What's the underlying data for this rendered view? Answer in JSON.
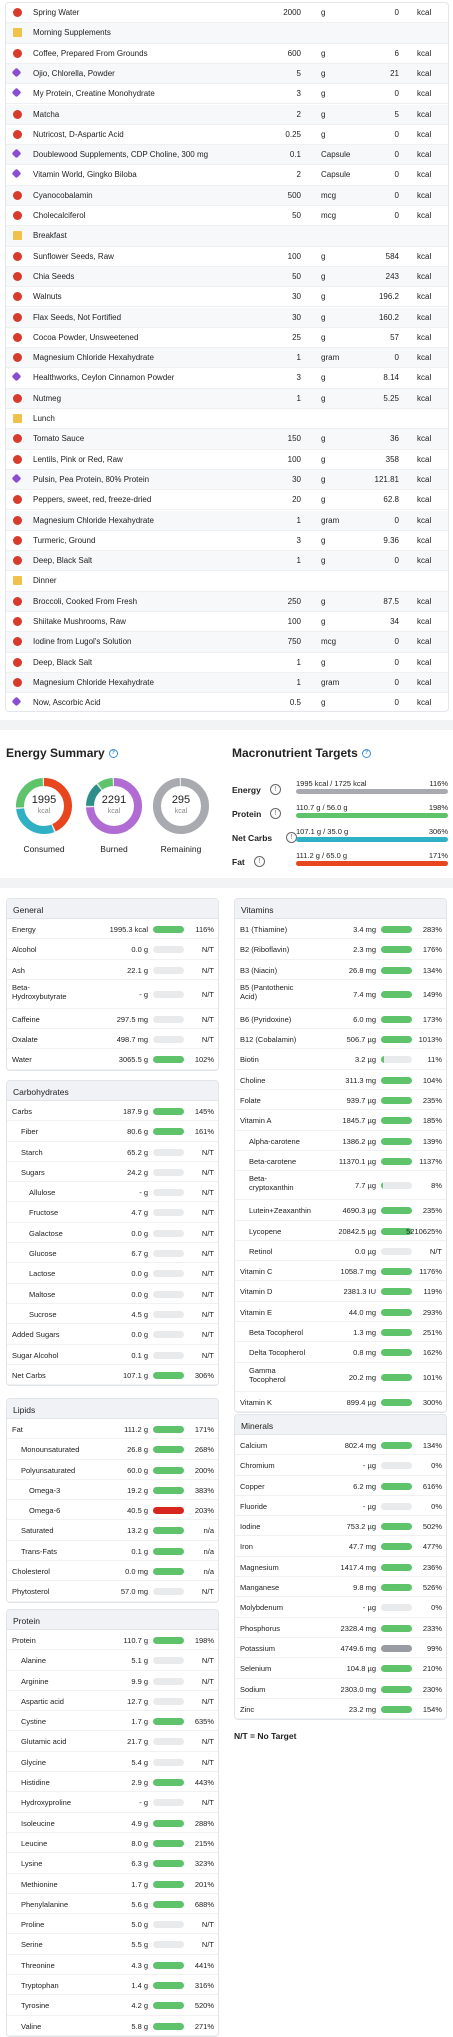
{
  "diary": [
    {
      "t": "food",
      "n": "Spring Water",
      "a": "2000",
      "u": "g",
      "k": "0",
      "ku": "kcal"
    },
    {
      "t": "folder",
      "n": "Morning Supplements"
    },
    {
      "t": "food",
      "n": "Coffee, Prepared From Grounds",
      "a": "600",
      "u": "g",
      "k": "6",
      "ku": "kcal"
    },
    {
      "t": "supp",
      "n": "Ojio, Chlorella, Powder",
      "a": "5",
      "u": "g",
      "k": "21",
      "ku": "kcal"
    },
    {
      "t": "supp",
      "n": "My Protein, Creatine Monohydrate",
      "a": "3",
      "u": "g",
      "k": "0",
      "ku": "kcal"
    },
    {
      "t": "food",
      "n": "Matcha",
      "a": "2",
      "u": "g",
      "k": "5",
      "ku": "kcal"
    },
    {
      "t": "food",
      "n": "Nutricost, D-Aspartic Acid",
      "a": "0.25",
      "u": "g",
      "k": "0",
      "ku": "kcal"
    },
    {
      "t": "supp",
      "n": "Doublewood Supplements, CDP Choline, 300 mg",
      "a": "0.1",
      "u": "Capsule",
      "k": "0",
      "ku": "kcal"
    },
    {
      "t": "supp",
      "n": "Vitamin World, Gingko Biloba",
      "a": "2",
      "u": "Capsule",
      "k": "0",
      "ku": "kcal"
    },
    {
      "t": "food",
      "n": "Cyanocobalamin",
      "a": "500",
      "u": "mcg",
      "k": "0",
      "ku": "kcal"
    },
    {
      "t": "food",
      "n": "Cholecalciferol",
      "a": "50",
      "u": "mcg",
      "k": "0",
      "ku": "kcal"
    },
    {
      "t": "folder",
      "n": "Breakfast"
    },
    {
      "t": "food",
      "n": "Sunflower Seeds, Raw",
      "a": "100",
      "u": "g",
      "k": "584",
      "ku": "kcal"
    },
    {
      "t": "food",
      "n": "Chia Seeds",
      "a": "50",
      "u": "g",
      "k": "243",
      "ku": "kcal"
    },
    {
      "t": "food",
      "n": "Walnuts",
      "a": "30",
      "u": "g",
      "k": "196.2",
      "ku": "kcal"
    },
    {
      "t": "food",
      "n": "Flax Seeds, Not Fortified",
      "a": "30",
      "u": "g",
      "k": "160.2",
      "ku": "kcal"
    },
    {
      "t": "food",
      "n": "Cocoa Powder, Unsweetened",
      "a": "25",
      "u": "g",
      "k": "57",
      "ku": "kcal"
    },
    {
      "t": "food",
      "n": "Magnesium Chloride Hexahydrate",
      "a": "1",
      "u": "gram",
      "k": "0",
      "ku": "kcal"
    },
    {
      "t": "supp",
      "n": "Healthworks, Ceylon Cinnamon Powder",
      "a": "3",
      "u": "g",
      "k": "8.14",
      "ku": "kcal"
    },
    {
      "t": "food",
      "n": "Nutmeg",
      "a": "1",
      "u": "g",
      "k": "5.25",
      "ku": "kcal"
    },
    {
      "t": "folder",
      "n": "Lunch"
    },
    {
      "t": "food",
      "n": "Tomato Sauce",
      "a": "150",
      "u": "g",
      "k": "36",
      "ku": "kcal"
    },
    {
      "t": "food",
      "n": "Lentils, Pink or Red, Raw",
      "a": "100",
      "u": "g",
      "k": "358",
      "ku": "kcal"
    },
    {
      "t": "supp",
      "n": "Pulsin, Pea Protein, 80% Protein",
      "a": "30",
      "u": "g",
      "k": "121.81",
      "ku": "kcal"
    },
    {
      "t": "food",
      "n": "Peppers, sweet, red, freeze-dried",
      "a": "20",
      "u": "g",
      "k": "62.8",
      "ku": "kcal"
    },
    {
      "t": "food",
      "n": "Magnesium Chloride Hexahydrate",
      "a": "1",
      "u": "gram",
      "k": "0",
      "ku": "kcal"
    },
    {
      "t": "food",
      "n": "Turmeric, Ground",
      "a": "3",
      "u": "g",
      "k": "9.36",
      "ku": "kcal"
    },
    {
      "t": "food",
      "n": "Deep, Black Salt",
      "a": "1",
      "u": "g",
      "k": "0",
      "ku": "kcal"
    },
    {
      "t": "folder",
      "n": "Dinner"
    },
    {
      "t": "food",
      "n": "Broccoli, Cooked From Fresh",
      "a": "250",
      "u": "g",
      "k": "87.5",
      "ku": "kcal"
    },
    {
      "t": "food",
      "n": "Shiitake Mushrooms, Raw",
      "a": "100",
      "u": "g",
      "k": "34",
      "ku": "kcal"
    },
    {
      "t": "food",
      "n": "Iodine from Lugol's Solution",
      "a": "750",
      "u": "mcg",
      "k": "0",
      "ku": "kcal"
    },
    {
      "t": "food",
      "n": "Deep, Black Salt",
      "a": "1",
      "u": "g",
      "k": "0",
      "ku": "kcal"
    },
    {
      "t": "food",
      "n": "Magnesium Chloride Hexahydrate",
      "a": "1",
      "u": "gram",
      "k": "0",
      "ku": "kcal"
    },
    {
      "t": "supp",
      "n": "Now, Ascorbic Acid",
      "a": "0.5",
      "u": "g",
      "k": "0",
      "ku": "kcal"
    }
  ],
  "energy": {
    "title": "Energy Summary",
    "help": "?",
    "rings": [
      {
        "num": "1995",
        "unit": "kcal",
        "label": "Consumed",
        "colors": [
          "#e8461f",
          "#2fb0c4",
          "#5ec36a"
        ],
        "fracs": [
          0.44,
          0.3,
          0.26
        ]
      },
      {
        "num": "2291",
        "unit": "kcal",
        "label": "Burned",
        "colors": [
          "#b06cd2",
          "#2e8f8a",
          "#5ec36a"
        ],
        "fracs": [
          0.75,
          0.15,
          0.1
        ]
      },
      {
        "num": "295",
        "unit": "kcal",
        "label": "Remaining",
        "colors": [
          "#a8aab0"
        ],
        "fracs": [
          1.0
        ]
      }
    ]
  },
  "macros": {
    "title": "Macronutrient Targets",
    "help": "?",
    "info": "!",
    "rows": [
      {
        "l": "Energy",
        "t": "1995 kcal / 1725 kcal",
        "p": "116%",
        "c": "#a8aab0",
        "f": 1.0
      },
      {
        "l": "Protein",
        "t": "110.7 g / 56.0 g",
        "p": "198%",
        "c": "#5ec36a",
        "f": 1.0
      },
      {
        "l": "Net Carbs",
        "t": "107.1 g / 35.0 g",
        "p": "306%",
        "c": "#2fb0c4",
        "f": 1.0
      },
      {
        "l": "Fat",
        "t": "111.2 g / 65.0 g",
        "p": "171%",
        "c": "#e8461f",
        "f": 1.0
      }
    ]
  },
  "panels": {
    "general": {
      "title": "General",
      "rows": [
        {
          "l": "Energy",
          "v": "1995.3 kcal",
          "p": "116%",
          "f": 1
        },
        {
          "l": "Alcohol",
          "v": "0.0 g",
          "p": "N/T",
          "f": 0
        },
        {
          "l": "Ash",
          "v": "22.1 g",
          "p": "N/T",
          "f": 0
        },
        {
          "l": "Beta-Hydroxybutyrate",
          "v": "- g",
          "p": "N/T",
          "f": 0,
          "tall": true
        },
        {
          "l": "Caffeine",
          "v": "297.5 mg",
          "p": "N/T",
          "f": 0
        },
        {
          "l": "Oxalate",
          "v": "498.7 mg",
          "p": "N/T",
          "f": 0
        },
        {
          "l": "Water",
          "v": "3065.5 g",
          "p": "102%",
          "f": 1
        }
      ]
    },
    "carbs": {
      "title": "Carbohydrates",
      "rows": [
        {
          "l": "Carbs",
          "v": "187.9 g",
          "p": "145%",
          "f": 1
        },
        {
          "l": "Fiber",
          "v": "80.6 g",
          "p": "161%",
          "f": 1,
          "i": 1
        },
        {
          "l": "Starch",
          "v": "65.2 g",
          "p": "N/T",
          "f": 0,
          "i": 1
        },
        {
          "l": "Sugars",
          "v": "24.2 g",
          "p": "N/T",
          "f": 0,
          "i": 1
        },
        {
          "l": "Allulose",
          "v": "- g",
          "p": "N/T",
          "f": 0,
          "i": 2
        },
        {
          "l": "Fructose",
          "v": "4.7 g",
          "p": "N/T",
          "f": 0,
          "i": 2
        },
        {
          "l": "Galactose",
          "v": "0.0 g",
          "p": "N/T",
          "f": 0,
          "i": 2
        },
        {
          "l": "Glucose",
          "v": "6.7 g",
          "p": "N/T",
          "f": 0,
          "i": 2
        },
        {
          "l": "Lactose",
          "v": "0.0 g",
          "p": "N/T",
          "f": 0,
          "i": 2
        },
        {
          "l": "Maltose",
          "v": "0.0 g",
          "p": "N/T",
          "f": 0,
          "i": 2
        },
        {
          "l": "Sucrose",
          "v": "4.5 g",
          "p": "N/T",
          "f": 0,
          "i": 2
        },
        {
          "l": "Added Sugars",
          "v": "0.0 g",
          "p": "N/T",
          "f": 0
        },
        {
          "l": "Sugar Alcohol",
          "v": "0.1 g",
          "p": "N/T",
          "f": 0
        },
        {
          "l": "Net Carbs",
          "v": "107.1 g",
          "p": "306%",
          "f": 1
        }
      ]
    },
    "lipids": {
      "title": "Lipids",
      "rows": [
        {
          "l": "Fat",
          "v": "111.2 g",
          "p": "171%",
          "f": 1
        },
        {
          "l": "Monounsaturated",
          "v": "26.8 g",
          "p": "268%",
          "f": 1,
          "i": 1
        },
        {
          "l": "Polyunsaturated",
          "v": "60.0 g",
          "p": "200%",
          "f": 1,
          "i": 1
        },
        {
          "l": "Omega-3",
          "v": "19.2 g",
          "p": "383%",
          "f": 1,
          "i": 2
        },
        {
          "l": "Omega-6",
          "v": "40.5 g",
          "p": "203%",
          "f": 1,
          "i": 2,
          "red": true
        },
        {
          "l": "Saturated",
          "v": "13.2 g",
          "p": "n/a",
          "f": 1,
          "i": 1
        },
        {
          "l": "Trans-Fats",
          "v": "0.1 g",
          "p": "n/a",
          "f": 1,
          "i": 1
        },
        {
          "l": "Cholesterol",
          "v": "0.0 mg",
          "p": "n/a",
          "f": 1
        },
        {
          "l": "Phytosterol",
          "v": "57.0 mg",
          "p": "N/T",
          "f": 0
        }
      ]
    },
    "protein": {
      "title": "Protein",
      "rows": [
        {
          "l": "Protein",
          "v": "110.7 g",
          "p": "198%",
          "f": 1
        },
        {
          "l": "Alanine",
          "v": "5.1 g",
          "p": "N/T",
          "f": 0,
          "i": 1
        },
        {
          "l": "Arginine",
          "v": "9.9 g",
          "p": "N/T",
          "f": 0,
          "i": 1
        },
        {
          "l": "Aspartic acid",
          "v": "12.7 g",
          "p": "N/T",
          "f": 0,
          "i": 1
        },
        {
          "l": "Cystine",
          "v": "1.7 g",
          "p": "635%",
          "f": 1,
          "i": 1
        },
        {
          "l": "Glutamic acid",
          "v": "21.7 g",
          "p": "N/T",
          "f": 0,
          "i": 1
        },
        {
          "l": "Glycine",
          "v": "5.4 g",
          "p": "N/T",
          "f": 0,
          "i": 1
        },
        {
          "l": "Histidine",
          "v": "2.9 g",
          "p": "443%",
          "f": 1,
          "i": 1
        },
        {
          "l": "Hydroxyproline",
          "v": "- g",
          "p": "N/T",
          "f": 0,
          "i": 1
        },
        {
          "l": "Isoleucine",
          "v": "4.9 g",
          "p": "288%",
          "f": 1,
          "i": 1
        },
        {
          "l": "Leucine",
          "v": "8.0 g",
          "p": "215%",
          "f": 1,
          "i": 1
        },
        {
          "l": "Lysine",
          "v": "6.3 g",
          "p": "323%",
          "f": 1,
          "i": 1
        },
        {
          "l": "Methionine",
          "v": "1.7 g",
          "p": "201%",
          "f": 1,
          "i": 1
        },
        {
          "l": "Phenylalanine",
          "v": "5.6 g",
          "p": "688%",
          "f": 1,
          "i": 1
        },
        {
          "l": "Proline",
          "v": "5.0 g",
          "p": "N/T",
          "f": 0,
          "i": 1
        },
        {
          "l": "Serine",
          "v": "5.5 g",
          "p": "N/T",
          "f": 0,
          "i": 1
        },
        {
          "l": "Threonine",
          "v": "4.3 g",
          "p": "441%",
          "f": 1,
          "i": 1
        },
        {
          "l": "Tryptophan",
          "v": "1.4 g",
          "p": "316%",
          "f": 1,
          "i": 1
        },
        {
          "l": "Tyrosine",
          "v": "4.2 g",
          "p": "520%",
          "f": 1,
          "i": 1
        },
        {
          "l": "Valine",
          "v": "5.8 g",
          "p": "271%",
          "f": 1,
          "i": 1
        }
      ]
    },
    "vitamins": {
      "title": "Vitamins",
      "rows": [
        {
          "l": "B1 (Thiamine)",
          "v": "3.4 mg",
          "p": "283%",
          "f": 1
        },
        {
          "l": "B2 (Riboflavin)",
          "v": "2.3 mg",
          "p": "176%",
          "f": 1
        },
        {
          "l": "B3 (Niacin)",
          "v": "26.8 mg",
          "p": "134%",
          "f": 1
        },
        {
          "l": "B5 (Pantothenic Acid)",
          "v": "7.4 mg",
          "p": "149%",
          "f": 1,
          "tall": true
        },
        {
          "l": "B6 (Pyridoxine)",
          "v": "6.0 mg",
          "p": "173%",
          "f": 1
        },
        {
          "l": "B12 (Cobalamin)",
          "v": "506.7 µg",
          "p": "1013%",
          "f": 1
        },
        {
          "l": "Biotin",
          "v": "3.2 µg",
          "p": "11%",
          "f": 0.11
        },
        {
          "l": "Choline",
          "v": "311.3 mg",
          "p": "104%",
          "f": 1
        },
        {
          "l": "Folate",
          "v": "939.7 µg",
          "p": "235%",
          "f": 1
        },
        {
          "l": "Vitamin A",
          "v": "1845.7 µg",
          "p": "185%",
          "f": 1
        },
        {
          "l": "Alpha-carotene",
          "v": "1386.2 µg",
          "p": "139%",
          "f": 1,
          "i": 1
        },
        {
          "l": "Beta-carotene",
          "v": "11370.1 µg",
          "p": "1137%",
          "f": 1,
          "i": 1
        },
        {
          "l": "Beta-cryptoxanthin",
          "v": "7.7 µg",
          "p": "8%",
          "f": 0.08,
          "i": 1,
          "tall": true
        },
        {
          "l": "Lutein+Zeaxanthin",
          "v": "4690.3 µg",
          "p": "235%",
          "f": 1,
          "i": 1
        },
        {
          "l": "Lycopene",
          "v": "20842.5 µg",
          "p": "5210625%",
          "f": 1,
          "i": 1
        },
        {
          "l": "Retinol",
          "v": "0.0 µg",
          "p": "N/T",
          "f": 0,
          "i": 1
        },
        {
          "l": "Vitamin C",
          "v": "1058.7 mg",
          "p": "1176%",
          "f": 1
        },
        {
          "l": "Vitamin D",
          "v": "2381.3 IU",
          "p": "119%",
          "f": 1
        },
        {
          "l": "Vitamin E",
          "v": "44.0 mg",
          "p": "293%",
          "f": 1
        },
        {
          "l": "Beta Tocopherol",
          "v": "1.3 mg",
          "p": "251%",
          "f": 1,
          "i": 1
        },
        {
          "l": "Delta Tocopherol",
          "v": "0.8 mg",
          "p": "162%",
          "f": 1,
          "i": 1
        },
        {
          "l": "Gamma Tocopherol",
          "v": "20.2 mg",
          "p": "101%",
          "f": 1,
          "i": 1,
          "tall": true
        },
        {
          "l": "Vitamin K",
          "v": "899.4 µg",
          "p": "300%",
          "f": 1
        }
      ]
    },
    "minerals": {
      "title": "Minerals",
      "rows": [
        {
          "l": "Calcium",
          "v": "802.4 mg",
          "p": "134%",
          "f": 1
        },
        {
          "l": "Chromium",
          "v": "- µg",
          "p": "0%",
          "f": 0
        },
        {
          "l": "Copper",
          "v": "6.2 mg",
          "p": "616%",
          "f": 1
        },
        {
          "l": "Fluoride",
          "v": "- µg",
          "p": "0%",
          "f": 0
        },
        {
          "l": "Iodine",
          "v": "753.2 µg",
          "p": "502%",
          "f": 1
        },
        {
          "l": "Iron",
          "v": "47.7 mg",
          "p": "477%",
          "f": 1
        },
        {
          "l": "Magnesium",
          "v": "1417.4 mg",
          "p": "236%",
          "f": 1
        },
        {
          "l": "Manganese",
          "v": "9.8 mg",
          "p": "526%",
          "f": 1
        },
        {
          "l": "Molybdenum",
          "v": "- µg",
          "p": "0%",
          "f": 0
        },
        {
          "l": "Phosphorus",
          "v": "2328.4 mg",
          "p": "233%",
          "f": 1
        },
        {
          "l": "Potassium",
          "v": "4749.6 mg",
          "p": "99%",
          "f": 0.99,
          "grey": true
        },
        {
          "l": "Selenium",
          "v": "104.8 µg",
          "p": "210%",
          "f": 1
        },
        {
          "l": "Sodium",
          "v": "2303.0 mg",
          "p": "230%",
          "f": 1
        },
        {
          "l": "Zinc",
          "v": "23.2 mg",
          "p": "154%",
          "f": 1
        }
      ]
    }
  },
  "footer": {
    "nt": "N/T = No Target"
  }
}
